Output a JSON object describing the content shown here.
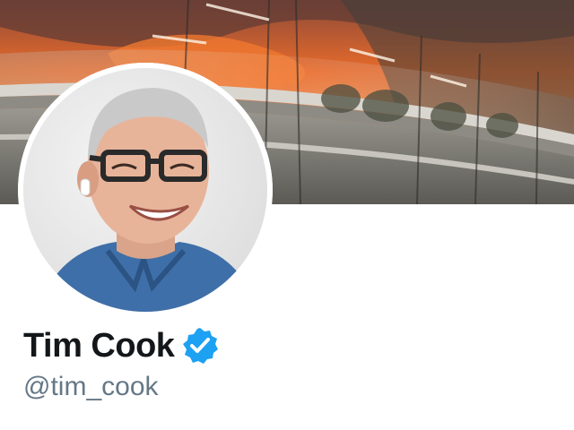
{
  "profile": {
    "display_name": "Tim Cook",
    "handle": "@tim_cook",
    "verified": true
  },
  "colors": {
    "verified_badge": "#1da1f2",
    "name_text": "#14171a",
    "handle_text": "#657786",
    "banner_sky": "#e86a2a"
  },
  "icons": {
    "verified": "verified-badge-icon"
  }
}
